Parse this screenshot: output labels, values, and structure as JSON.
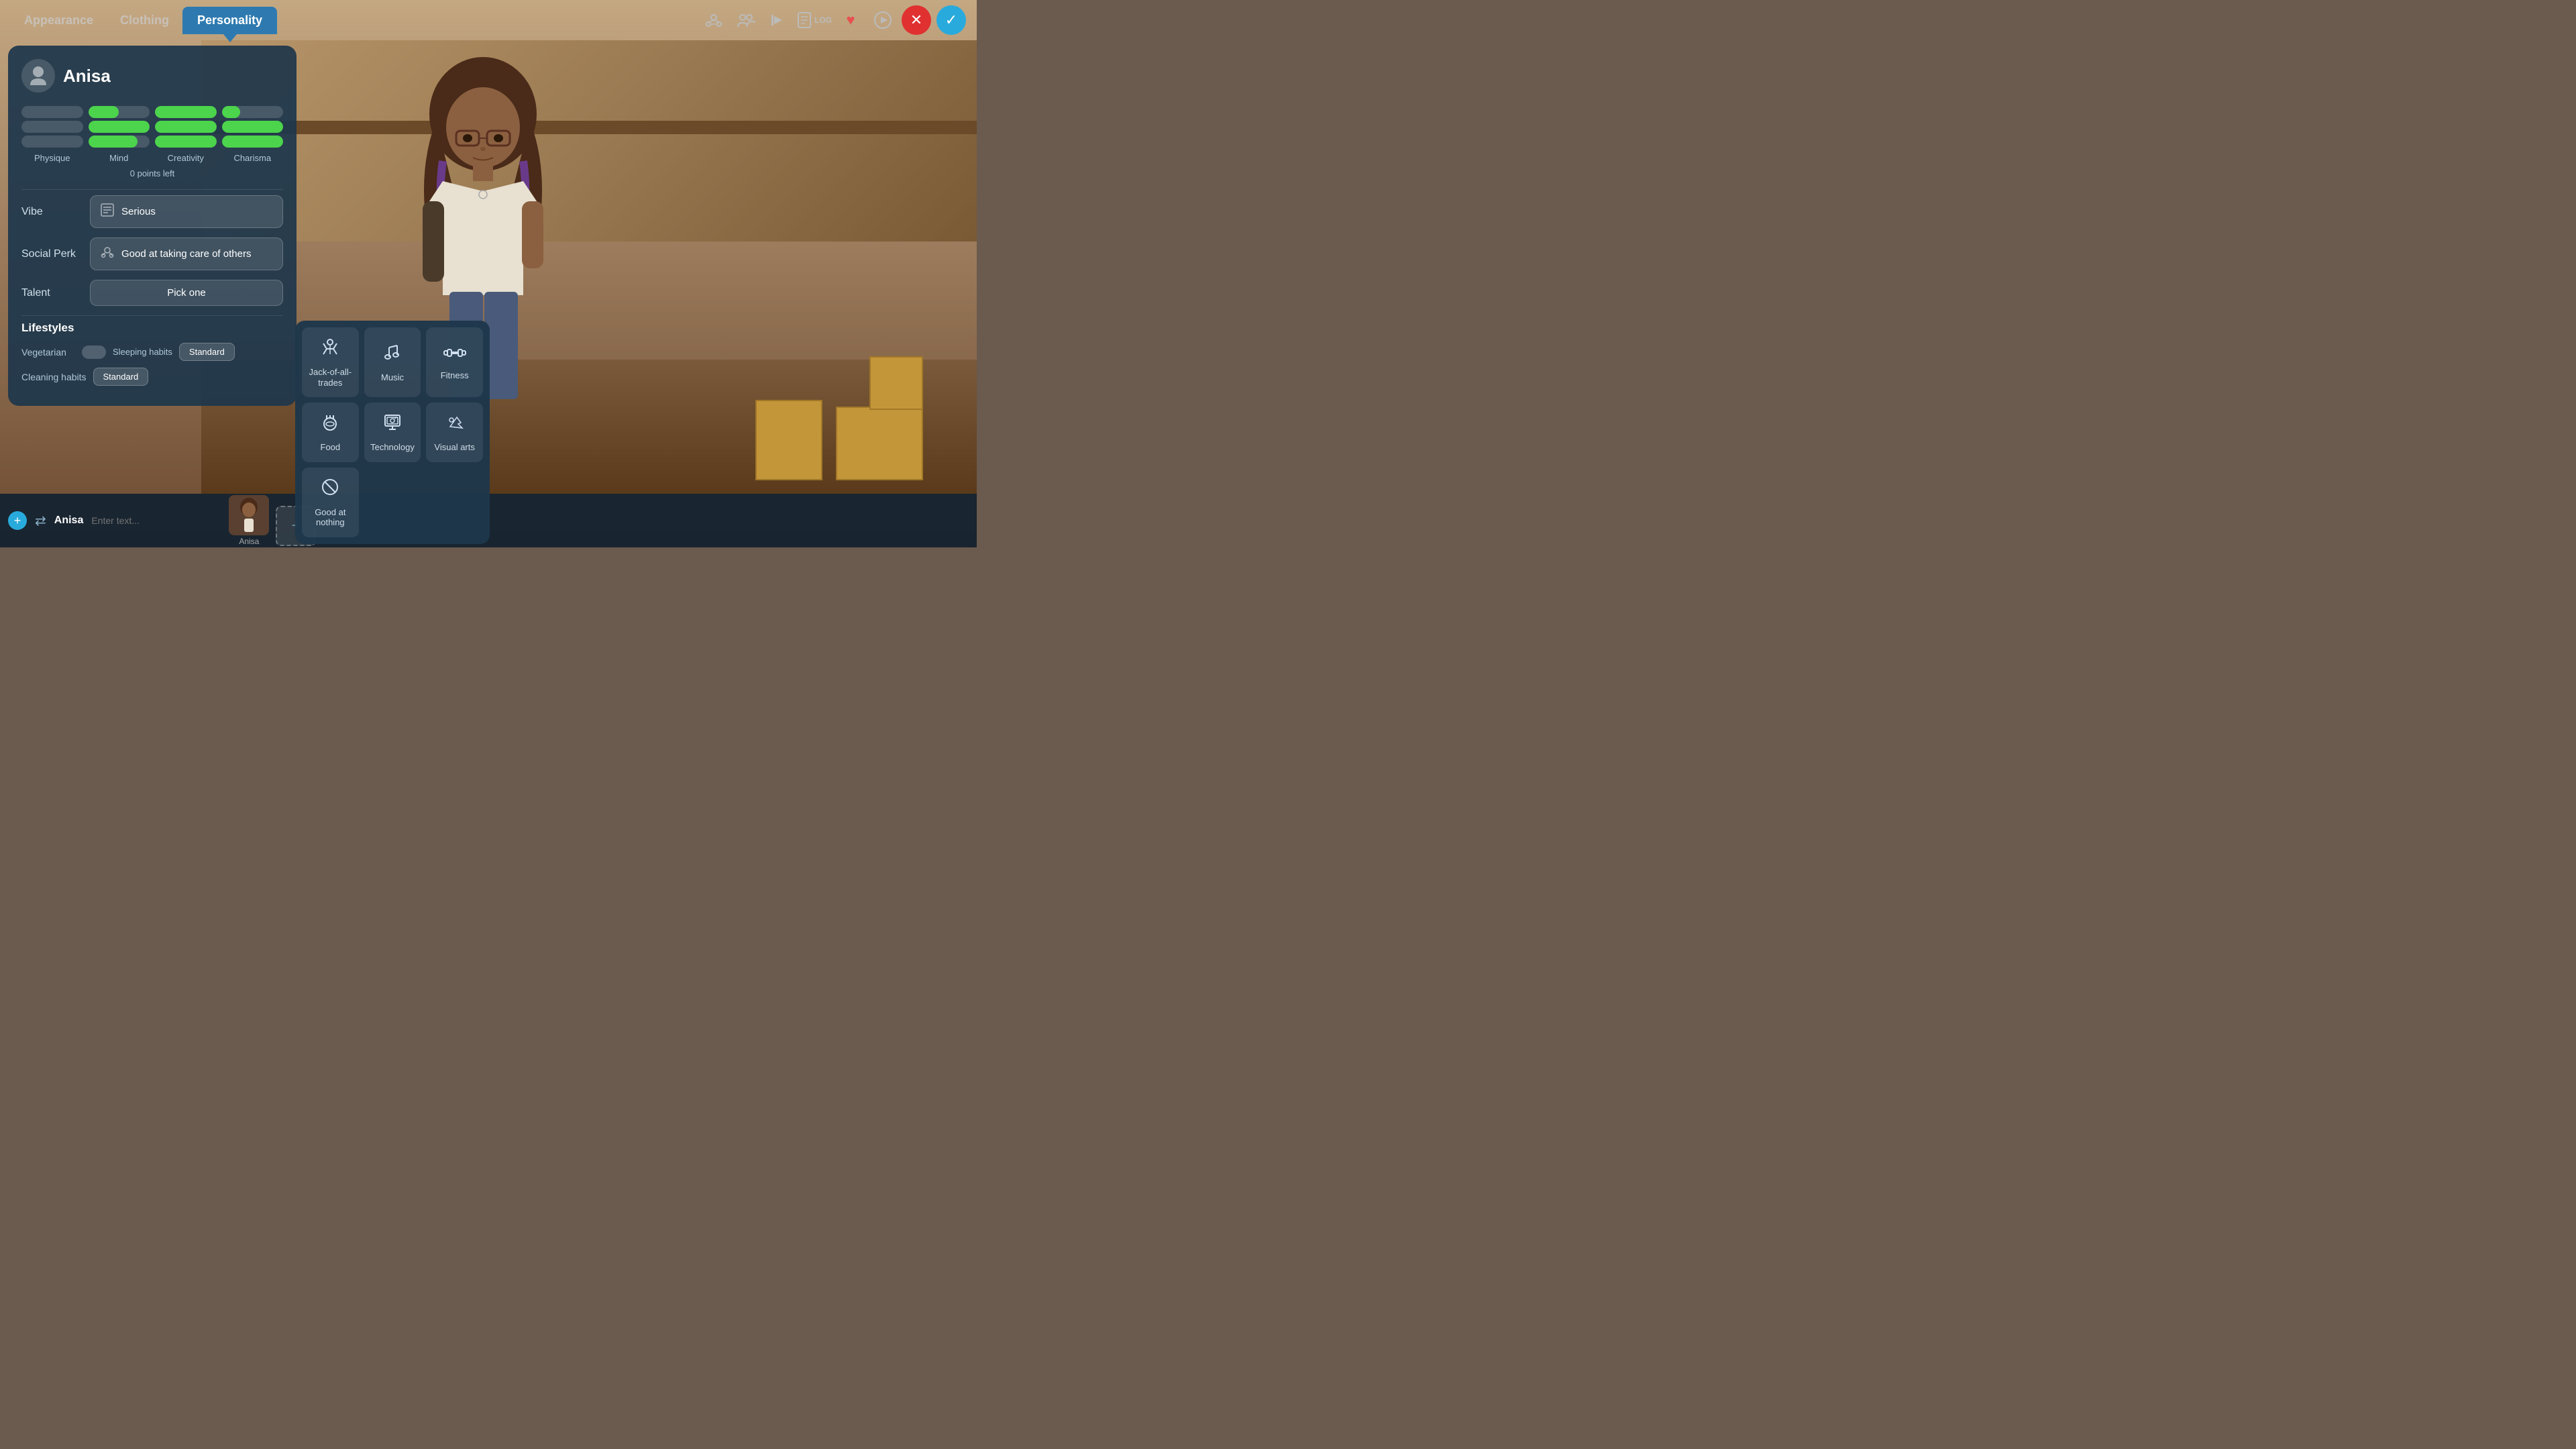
{
  "nav": {
    "tabs": [
      {
        "id": "appearance",
        "label": "Appearance",
        "active": false
      },
      {
        "id": "clothing",
        "label": "Clothing",
        "active": false
      },
      {
        "id": "personality",
        "label": "Personality",
        "active": true
      }
    ],
    "icons": {
      "connections": "⚙",
      "group": "👥",
      "action": "🤲",
      "log": "LOG",
      "heart": "♥",
      "play": "▶"
    },
    "cancel_label": "✕",
    "confirm_label": "✓"
  },
  "character": {
    "name": "Anisa",
    "avatar_icon": "👤",
    "stats": {
      "columns": [
        "Physique",
        "Mind",
        "Creativity",
        "Charisma"
      ],
      "rows": [
        [
          0,
          50,
          100,
          30
        ],
        [
          0,
          100,
          100,
          100
        ],
        [
          0,
          80,
          100,
          100
        ]
      ],
      "points_left": "0 points left"
    },
    "vibe": {
      "label": "Vibe",
      "value": "Serious",
      "icon": "📖"
    },
    "social_perk": {
      "label": "Social Perk",
      "value": "Good at taking care of others",
      "icon": "👥"
    },
    "talent": {
      "label": "Talent",
      "value": "Pick one"
    }
  },
  "lifestyles": {
    "title": "Lifestyles",
    "items": [
      {
        "label": "Vegetarian",
        "toggle": false,
        "sublabel": "Sleeping habits",
        "option": "Standard"
      },
      {
        "label": "Cleaning habits",
        "option": "Standard"
      }
    ]
  },
  "talent_dropdown": {
    "items": [
      {
        "id": "jack",
        "icon": "✦",
        "label": "Jack-of-all-trades"
      },
      {
        "id": "music",
        "icon": "♪",
        "label": "Music"
      },
      {
        "id": "fitness",
        "icon": "⊞",
        "label": "Fitness"
      },
      {
        "id": "food",
        "icon": "🍽",
        "label": "Food"
      },
      {
        "id": "technology",
        "icon": "⊡",
        "label": "Technology"
      },
      {
        "id": "visual_arts",
        "icon": "🎨",
        "label": "Visual arts"
      },
      {
        "id": "good_nothing",
        "icon": "⊘",
        "label": "Good at nothing"
      }
    ]
  },
  "bottom_bar": {
    "add_label": "+",
    "switch_icon": "⇄",
    "char_name": "Anisa",
    "placeholder": "Enter text...",
    "add_char_label": "+"
  }
}
